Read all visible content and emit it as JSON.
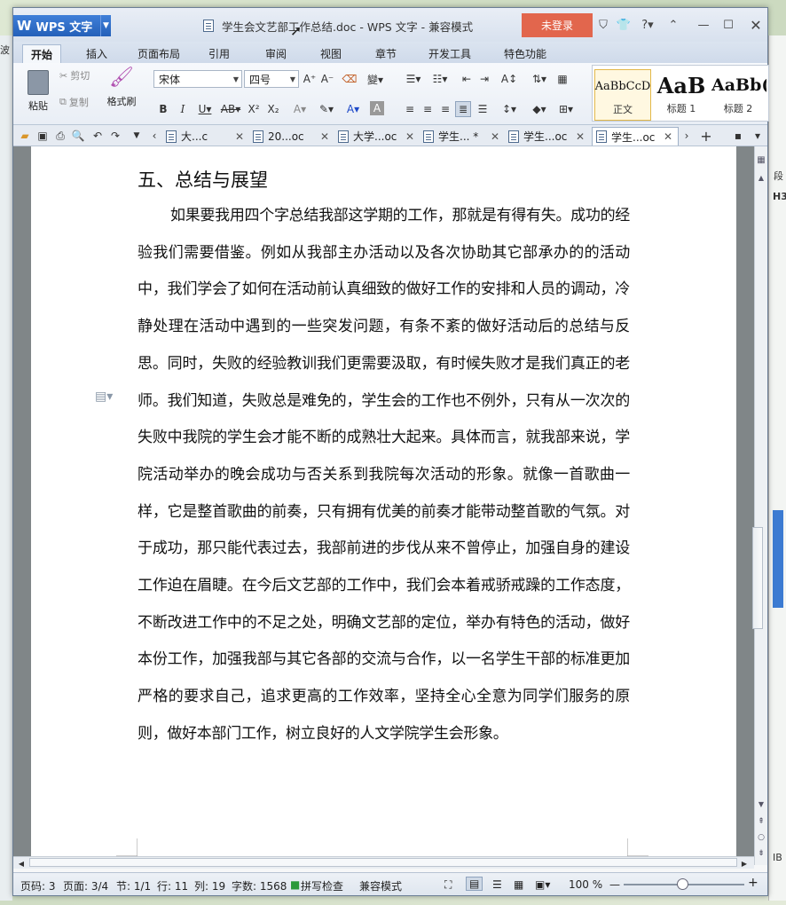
{
  "desktop": {
    "left_edge": "波",
    "right_edge_labels": [
      "段",
      "H3",
      "IB"
    ]
  },
  "window": {
    "app_button": "WPS 文字",
    "title": "学生会文艺部工作总结.doc - WPS 文字 - 兼容模式",
    "login_button": "未登录"
  },
  "ribbon_tabs": [
    "开始",
    "插入",
    "页面布局",
    "引用",
    "审阅",
    "视图",
    "章节",
    "开发工具",
    "特色功能"
  ],
  "ribbon": {
    "paste": "粘贴",
    "cut": "剪切",
    "copy": "复制",
    "format_painter": "格式刷",
    "font_name": "宋体",
    "font_size": "四号",
    "styles": [
      {
        "preview": "AaBbCcD",
        "label": "正文"
      },
      {
        "preview": "AaB",
        "label": "标题 1"
      },
      {
        "preview": "AaBb(",
        "label": "标题 2"
      }
    ]
  },
  "doc_tabs": [
    {
      "label": "大...c",
      "active": false
    },
    {
      "label": "20...oc",
      "active": false
    },
    {
      "label": "大学...oc",
      "active": false
    },
    {
      "label": "学生... *",
      "active": false
    },
    {
      "label": "学生...oc",
      "active": false
    },
    {
      "label": "学生...oc",
      "active": true
    }
  ],
  "document": {
    "heading": "五、总结与展望",
    "paragraph": "如果要我用四个字总结我部这学期的工作，那就是有得有失。成功的经验我们需要借鉴。例如从我部主办活动以及各次协助其它部承办的的活动中，我们学会了如何在活动前认真细致的做好工作的安排和人员的调动，冷静处理在活动中遇到的一些突发问题，有条不紊的做好活动后的总结与反思。同时，失败的经验教训我们更需要汲取，有时候失败才是我们真正的老师。我们知道，失败总是难免的，学生会的工作也不例外，只有从一次次的失败中我院的学生会才能不断的成熟壮大起来。具体而言，就我部来说，学院活动举办的晚会成功与否关系到我院每次活动的形象。就像一首歌曲一样，它是整首歌曲的前奏，只有拥有优美的前奏才能带动整首歌的气氛。对于成功，那只能代表过去，我部前进的步伐从来不曾停止，加强自身的建设工作迫在眉睫。在今后文艺部的工作中，我们会本着戒骄戒躁的工作态度，不断改进工作中的不足之处，明确文艺部的定位，举办有特色的活动，做好本份工作，加强我部与其它各部的交流与合作，以一名学生干部的标准更加严格的要求自己，追求更高的工作效率，坚持全心全意为同学们服务的原则，做好本部门工作，树立良好的人文学院学生会形象。"
  },
  "status": {
    "page_num": "页码: 3",
    "pages": "页面: 3/4",
    "section": "节: 1/1",
    "row": "行: 11",
    "col": "列: 19",
    "word_count": "字数: 1568",
    "spell_check": "拼写检查",
    "compat_mode": "兼容模式",
    "zoom": "100 %",
    "zoom_value": 100
  },
  "colors": {
    "accent": "#2460b9",
    "login": "#e2664d",
    "active_tab_text": "#1a1a1a"
  }
}
